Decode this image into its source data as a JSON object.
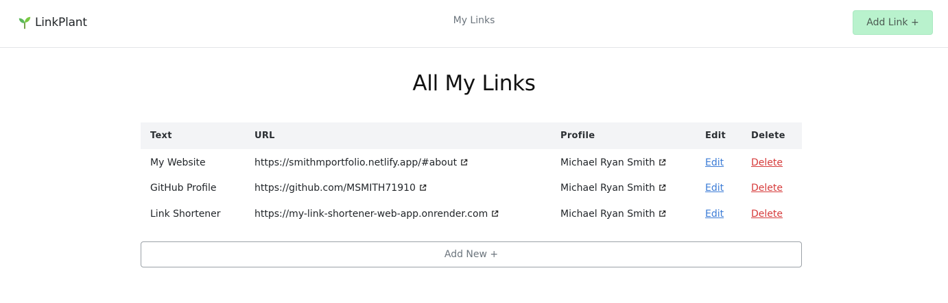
{
  "nav": {
    "brand": "LinkPlant",
    "center_link": "My Links",
    "add_link_button": "Add Link +"
  },
  "page": {
    "title": "All My Links"
  },
  "table": {
    "headers": {
      "text": "Text",
      "url": "URL",
      "profile": "Profile",
      "edit": "Edit",
      "delete": "Delete"
    },
    "rows": [
      {
        "text": "My Website",
        "url": "https://smithmportfolio.netlify.app/#about",
        "profile": "Michael Ryan Smith",
        "edit": "Edit",
        "delete": "Delete"
      },
      {
        "text": "GitHub Profile",
        "url": "https://github.com/MSMITH71910",
        "profile": "Michael Ryan Smith",
        "edit": "Edit",
        "delete": "Delete"
      },
      {
        "text": "Link Shortener",
        "url": "https://my-link-shortener-web-app.onrender.com",
        "profile": "Michael Ryan Smith",
        "edit": "Edit",
        "delete": "Delete"
      }
    ]
  },
  "add_new_button": "Add New +",
  "colors": {
    "add_link_bg": "#b9f2cd",
    "edit_link": "#3b7bd6",
    "delete_link": "#d63a3a",
    "brand_leaf": "#5cb85c"
  },
  "icons": {
    "brand": "seedling-icon",
    "external": "external-link-icon"
  }
}
